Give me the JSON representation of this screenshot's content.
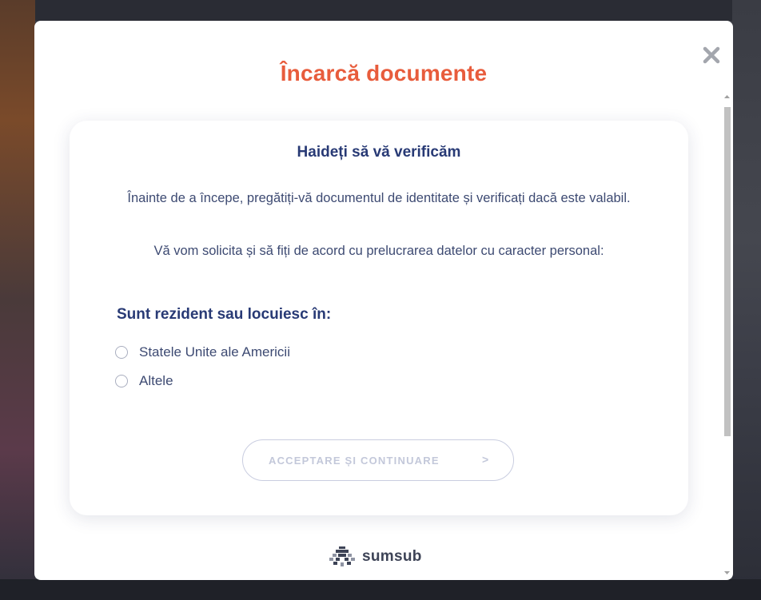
{
  "modal": {
    "title": "Încarcă documente",
    "close_icon": "close-icon"
  },
  "card": {
    "heading": "Haideți să vă verificăm",
    "intro_1": "Înainte de a începe, pregătiți-vă documentul de identitate și verificați dacă este valabil.",
    "intro_2": "Vă vom solicita și să fiți de acord cu prelucrarea datelor cu caracter personal:",
    "residence_title": "Sunt rezident sau locuiesc în:",
    "options": [
      {
        "label": "Statele Unite ale Americii",
        "selected": false
      },
      {
        "label": "Altele",
        "selected": false
      }
    ],
    "continue_label": "ACCEPTARE ȘI CONTINUARE",
    "continue_chevron": ">"
  },
  "brand": {
    "name": "sumsub",
    "logo_icon": "sumsub-logo-icon"
  },
  "colors": {
    "title_accent": "#e85c3c",
    "heading_navy": "#283a75",
    "body_text": "#3d4a72",
    "disabled_button_text": "#c3c8da"
  }
}
